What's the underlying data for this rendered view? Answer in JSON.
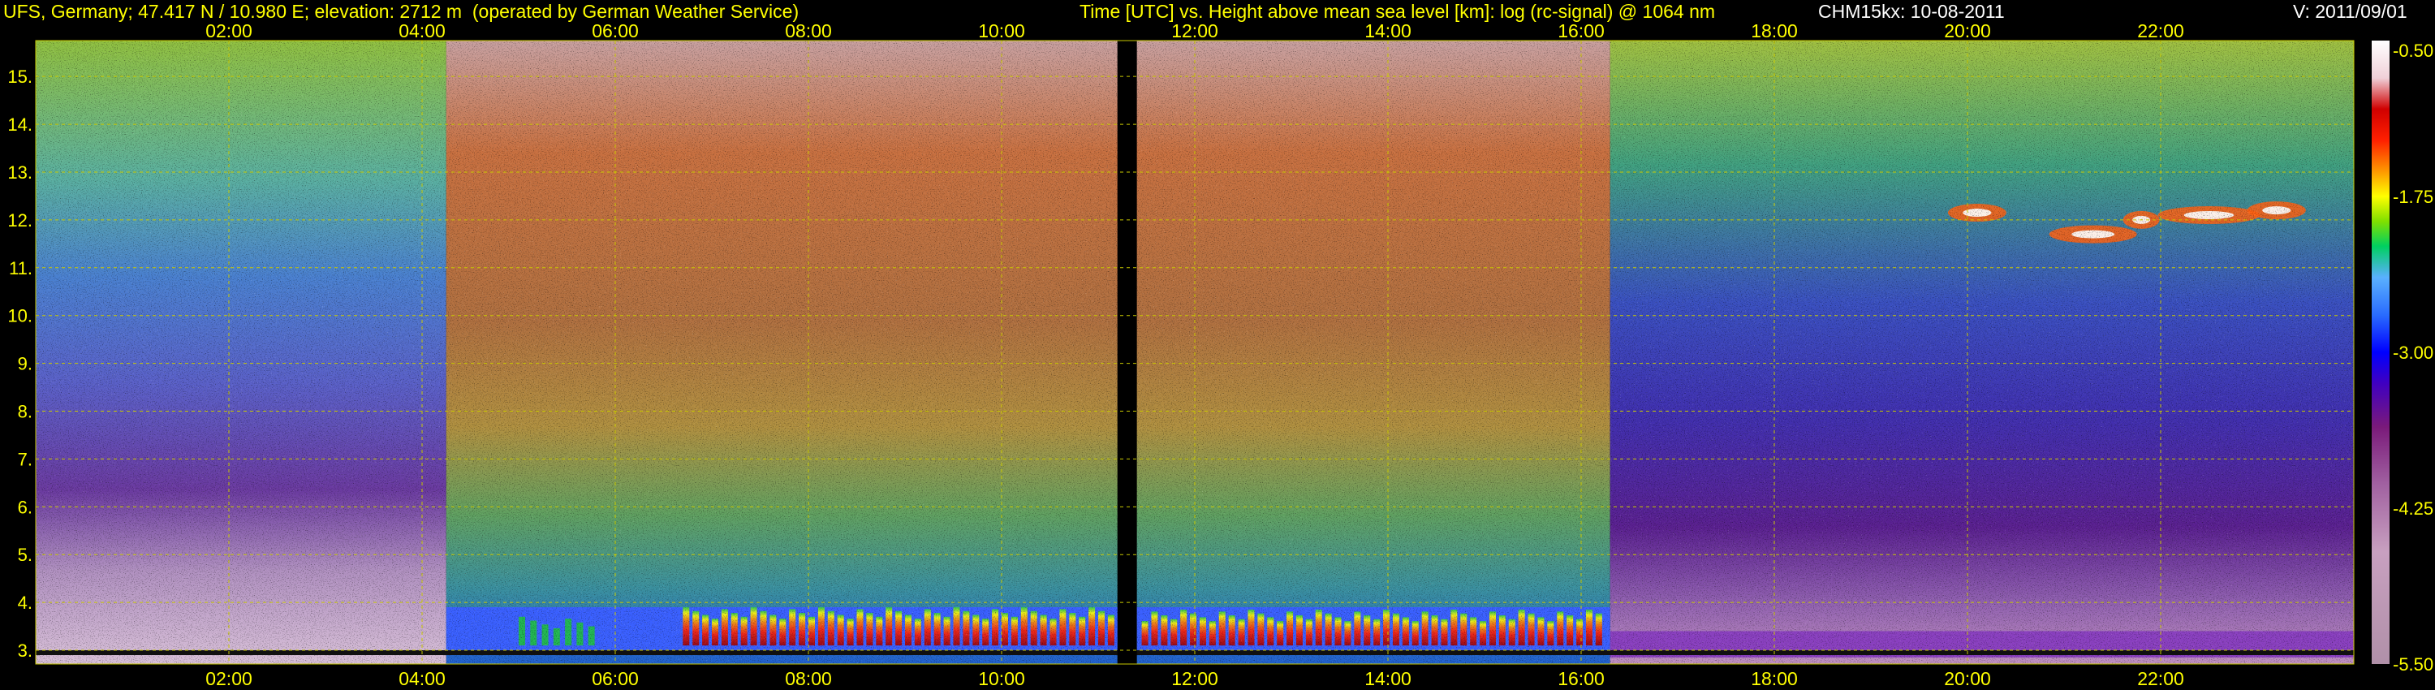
{
  "header": {
    "station": "UFS, Germany; 47.417 N / 10.980 E; elevation: 2712 m  (operated by German Weather Service)",
    "plot_title": "Time [UTC] vs. Height above mean sea level [km]: log (rc-signal) @ 1064 nm",
    "instrument_date": "CHM15kx: 10-08-2011",
    "version": "V: 2011/09/01"
  },
  "colors": {
    "text_primary": "#ffff00",
    "text_secondary": "#ffffff",
    "background": "#000000",
    "grid": "#c8c800"
  },
  "chart_data": {
    "type": "heatmap",
    "title": "Time [UTC] vs. Height above mean sea level [km]: log (rc-signal) @ 1064 nm",
    "x_ticks": [
      "02:00",
      "04:00",
      "06:00",
      "08:00",
      "10:00",
      "12:00",
      "14:00",
      "16:00",
      "18:00",
      "20:00",
      "22:00"
    ],
    "x_tick_hours": [
      2,
      4,
      6,
      8,
      10,
      12,
      14,
      16,
      18,
      20,
      22
    ],
    "xlim_hours": [
      0,
      24
    ],
    "y_ticks": [
      "3.",
      "4.",
      "5.",
      "6.",
      "7.",
      "8.",
      "9.",
      "10.",
      "11.",
      "12.",
      "13.",
      "14.",
      "15."
    ],
    "y_tick_values": [
      3,
      4,
      5,
      6,
      7,
      8,
      9,
      10,
      11,
      12,
      13,
      14,
      15
    ],
    "ylim_km": [
      2.712,
      15.75
    ],
    "grid": true,
    "colorbar": {
      "ticks": [
        "-0.50",
        "-1.75",
        "-3.00",
        "-4.25",
        "-5.50"
      ],
      "tick_values": [
        -0.5,
        -1.75,
        -3.0,
        -4.25,
        -5.5
      ],
      "range": [
        -5.5,
        -0.5
      ],
      "stops": [
        {
          "v": -5.5,
          "c": "#b090a8"
        },
        {
          "v": -4.6,
          "c": "#c8a0c0"
        },
        {
          "v": -4.05,
          "c": "#a060a0"
        },
        {
          "v": -3.6,
          "c": "#7a1a7a"
        },
        {
          "v": -3.25,
          "c": "#4000c0"
        },
        {
          "v": -3.0,
          "c": "#0000ff"
        },
        {
          "v": -2.7,
          "c": "#2a6cff"
        },
        {
          "v": -2.4,
          "c": "#5ab0ff"
        },
        {
          "v": -2.15,
          "c": "#00d060"
        },
        {
          "v": -1.95,
          "c": "#80e000"
        },
        {
          "v": -1.75,
          "c": "#ffff00"
        },
        {
          "v": -1.55,
          "c": "#ff9900"
        },
        {
          "v": -1.3,
          "c": "#ff2000"
        },
        {
          "v": -1.05,
          "c": "#d00000"
        },
        {
          "v": -0.8,
          "c": "#f0d0d8"
        },
        {
          "v": -0.5,
          "c": "#ffffff"
        }
      ]
    },
    "data_gap_hours": [
      11.2,
      11.4
    ]
  }
}
